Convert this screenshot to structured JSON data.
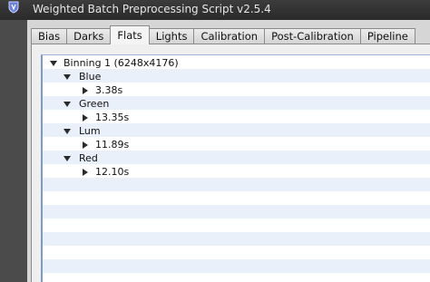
{
  "window": {
    "title": "Weighted Batch Preprocessing Script v2.5.4"
  },
  "tabs": [
    {
      "label": "Bias"
    },
    {
      "label": "Darks"
    },
    {
      "label": "Flats"
    },
    {
      "label": "Lights"
    },
    {
      "label": "Calibration"
    },
    {
      "label": "Post-Calibration"
    },
    {
      "label": "Pipeline"
    }
  ],
  "active_tab": "Flats",
  "tree": {
    "group": "Binning 1 (6248x4176)",
    "filters": [
      {
        "name": "Blue",
        "exposure": "3.38s"
      },
      {
        "name": "Green",
        "exposure": "13.35s"
      },
      {
        "name": "Lum",
        "exposure": "11.89s"
      },
      {
        "name": "Red",
        "exposure": "12.10s"
      }
    ]
  },
  "colors": {
    "title_bar": "#2f2f2f",
    "row_alt": "#e9f0f9",
    "tree_border": "#7d9ac8"
  }
}
